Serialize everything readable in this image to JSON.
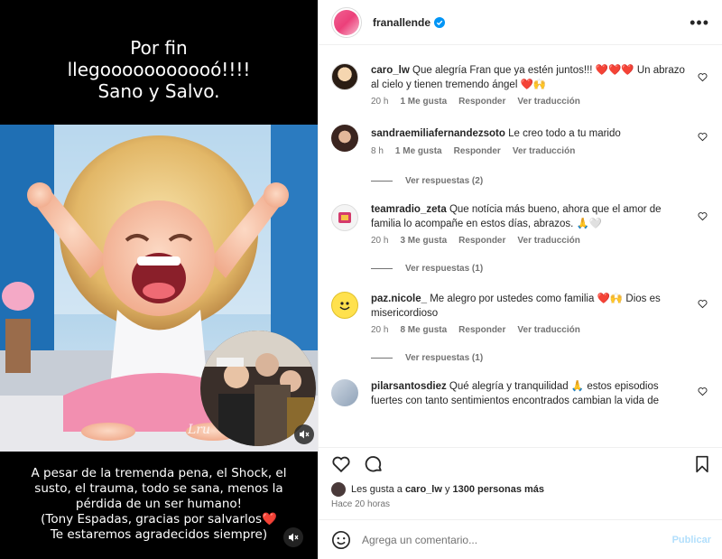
{
  "post": {
    "top_caption": "Por fin\nllegooooooooooó!!!!\nSano y Salvo.",
    "bottom_caption": "A pesar de la tremenda pena, el Shock, el\nsusto, el trauma, todo se sana, menos la\npérdida de un ser humano!\n(Tony Espadas, gracias por salvarlos❤️\nTe estaremos agradecidos siempre)",
    "watermark": "Lru"
  },
  "header": {
    "username": "franallende",
    "more_icon": "ellipsis-icon",
    "verified_icon": "verified-badge-icon",
    "accent_color": "#0095f6"
  },
  "comments": [
    {
      "username": "caro_lw",
      "text": "Que alegría Fran que ya estén juntos!!! ❤️❤️❤️ Un abrazo al cielo y tienen tremendo ángel ❤️🙌",
      "time": "20 h",
      "likes": "1 Me gusta",
      "reply": "Responder",
      "translate": "Ver traducción",
      "replies": ""
    },
    {
      "username": "sandraemiliafernandezsoto",
      "text": "Le creo todo a tu marido",
      "time": "8 h",
      "likes": "1 Me gusta",
      "reply": "Responder",
      "translate": "Ver traducción",
      "replies": "Ver respuestas (2)"
    },
    {
      "username": "teamradio_zeta",
      "text": "Que notícia más bueno, ahora que el amor de familia lo acompañe en estos días, abrazos. 🙏🤍",
      "time": "20 h",
      "likes": "3 Me gusta",
      "reply": "Responder",
      "translate": "Ver traducción",
      "replies": "Ver respuestas (1)"
    },
    {
      "username": "paz.nicole_",
      "text": "Me alegro por ustedes como familia ❤️🙌 Dios es misericordioso",
      "time": "20 h",
      "likes": "8 Me gusta",
      "reply": "Responder",
      "translate": "Ver traducción",
      "replies": "Ver respuestas (1)"
    },
    {
      "username": "pilarsantosdiez",
      "text": "Qué alegría y tranquilidad 🙏 estos episodios fuertes con tanto sentimientos encontrados cambian la vida de",
      "time": "",
      "likes": "",
      "reply": "",
      "translate": "",
      "replies": ""
    }
  ],
  "likes_line": {
    "prefix": "Les gusta a",
    "user": "caro_lw",
    "mid": "y",
    "count": "1300 personas más"
  },
  "time_ago": "Hace 20 horas",
  "composer": {
    "placeholder": "Agrega un comentario...",
    "post_label": "Publicar"
  }
}
